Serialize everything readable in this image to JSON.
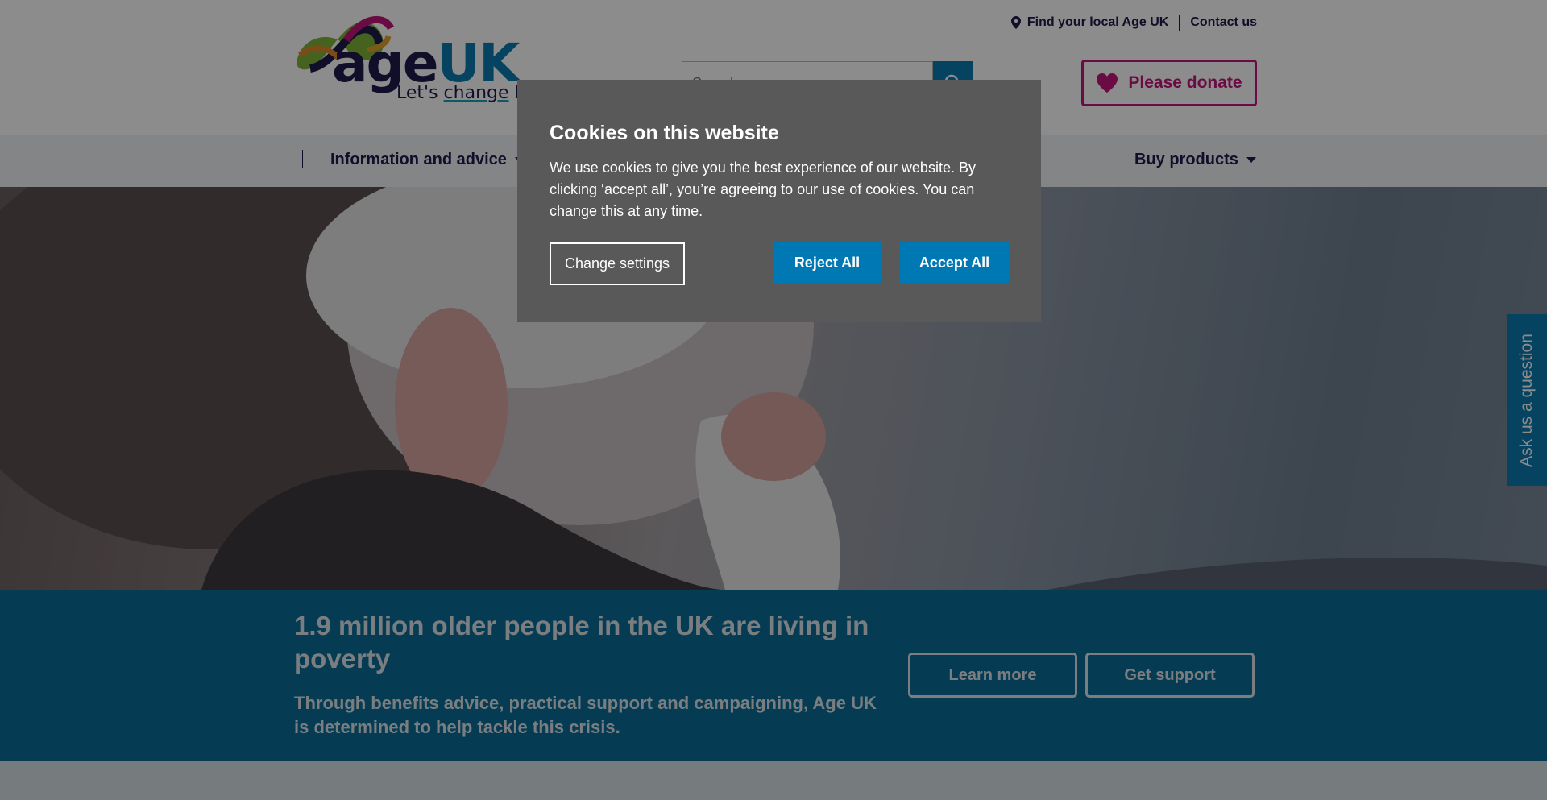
{
  "header": {
    "logo": {
      "brand_age": "age",
      "brand_uk": "UK",
      "tagline_prefix": "Let's",
      "tagline_change": "change",
      "tagline_suffix": "how"
    },
    "util_links": {
      "find_local": "Find your local Age UK",
      "contact": "Contact us"
    },
    "search": {
      "placeholder": "Search"
    },
    "donate_label": "Please donate"
  },
  "nav": {
    "items": [
      {
        "label": "Information and advice"
      },
      {
        "label": "Buy products"
      }
    ]
  },
  "banner": {
    "title": "1.9 million older people in the UK are living in poverty",
    "subtitle": "Through benefits advice, practical support and campaigning, Age UK is determined to help tackle this crisis.",
    "learn_more": "Learn more",
    "get_support": "Get support"
  },
  "ask_tab": {
    "label": "Ask us a question"
  },
  "cookie": {
    "title": "Cookies on this website",
    "text": "We use cookies to give you the best experience of our website. By clicking ‘accept all’, you’re agreeing to our use of cookies. You can change this at any time.",
    "change_settings": "Change settings",
    "reject_all": "Reject All",
    "accept_all": "Accept All"
  },
  "colors": {
    "brand_navy": "#1f1b4e",
    "brand_blue": "#0c7bb1",
    "donate_pink": "#c4157c",
    "banner_blue": "#0a6e99",
    "cookie_bg": "#595959",
    "cookie_button": "#0078b4"
  },
  "icons": [
    "ribbon-logo-icon",
    "location-pin-icon",
    "search-icon",
    "heart-icon",
    "caret-down-icon"
  ]
}
